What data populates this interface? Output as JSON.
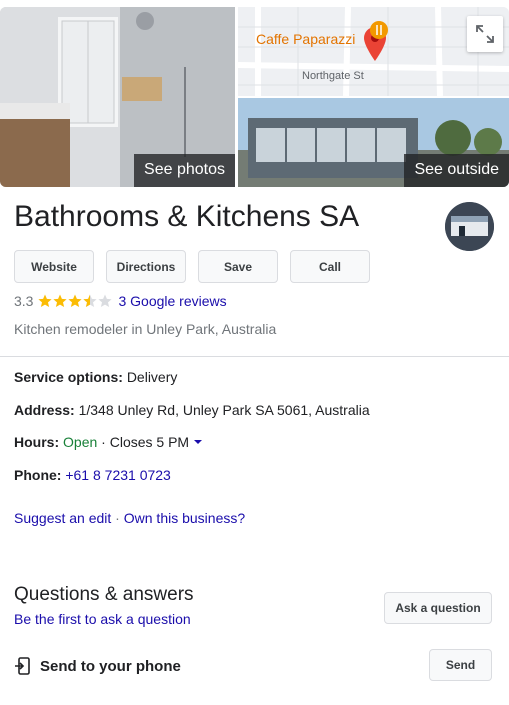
{
  "photos": {
    "left_label": "See photos",
    "outside_label": "See outside",
    "map": {
      "poi_name": "Caffe Paparazzi",
      "street_name": "Northgate St"
    }
  },
  "business": {
    "name": "Bathrooms & Kitchens SA",
    "rating": "3.3",
    "rating_value": 3.3,
    "reviews_label": "3 Google reviews",
    "category": "Kitchen remodeler in Unley Park, Australia"
  },
  "actions": {
    "website": "Website",
    "directions": "Directions",
    "save": "Save",
    "call": "Call"
  },
  "details": {
    "service_label": "Service options:",
    "service_value": "Delivery",
    "address_label": "Address:",
    "address_value": "1/348 Unley Rd, Unley Park SA 5061, Australia",
    "hours_label": "Hours:",
    "hours_status": "Open",
    "hours_sep": " · ",
    "hours_value": "Closes 5 PM",
    "phone_label": "Phone:",
    "phone_value": "+61 8 7231 0723"
  },
  "edits": {
    "suggest": "Suggest an edit",
    "sep": " · ",
    "own": "Own this business?"
  },
  "qa": {
    "title": "Questions & answers",
    "subtitle": "Be the first to ask a question",
    "ask_button": "Ask a question"
  },
  "send": {
    "label": "Send to your phone",
    "button": "Send"
  },
  "colors": {
    "link": "#1a0dab",
    "open": "#188038",
    "star": "#fbbc04",
    "map_pin": "#ea4335"
  }
}
